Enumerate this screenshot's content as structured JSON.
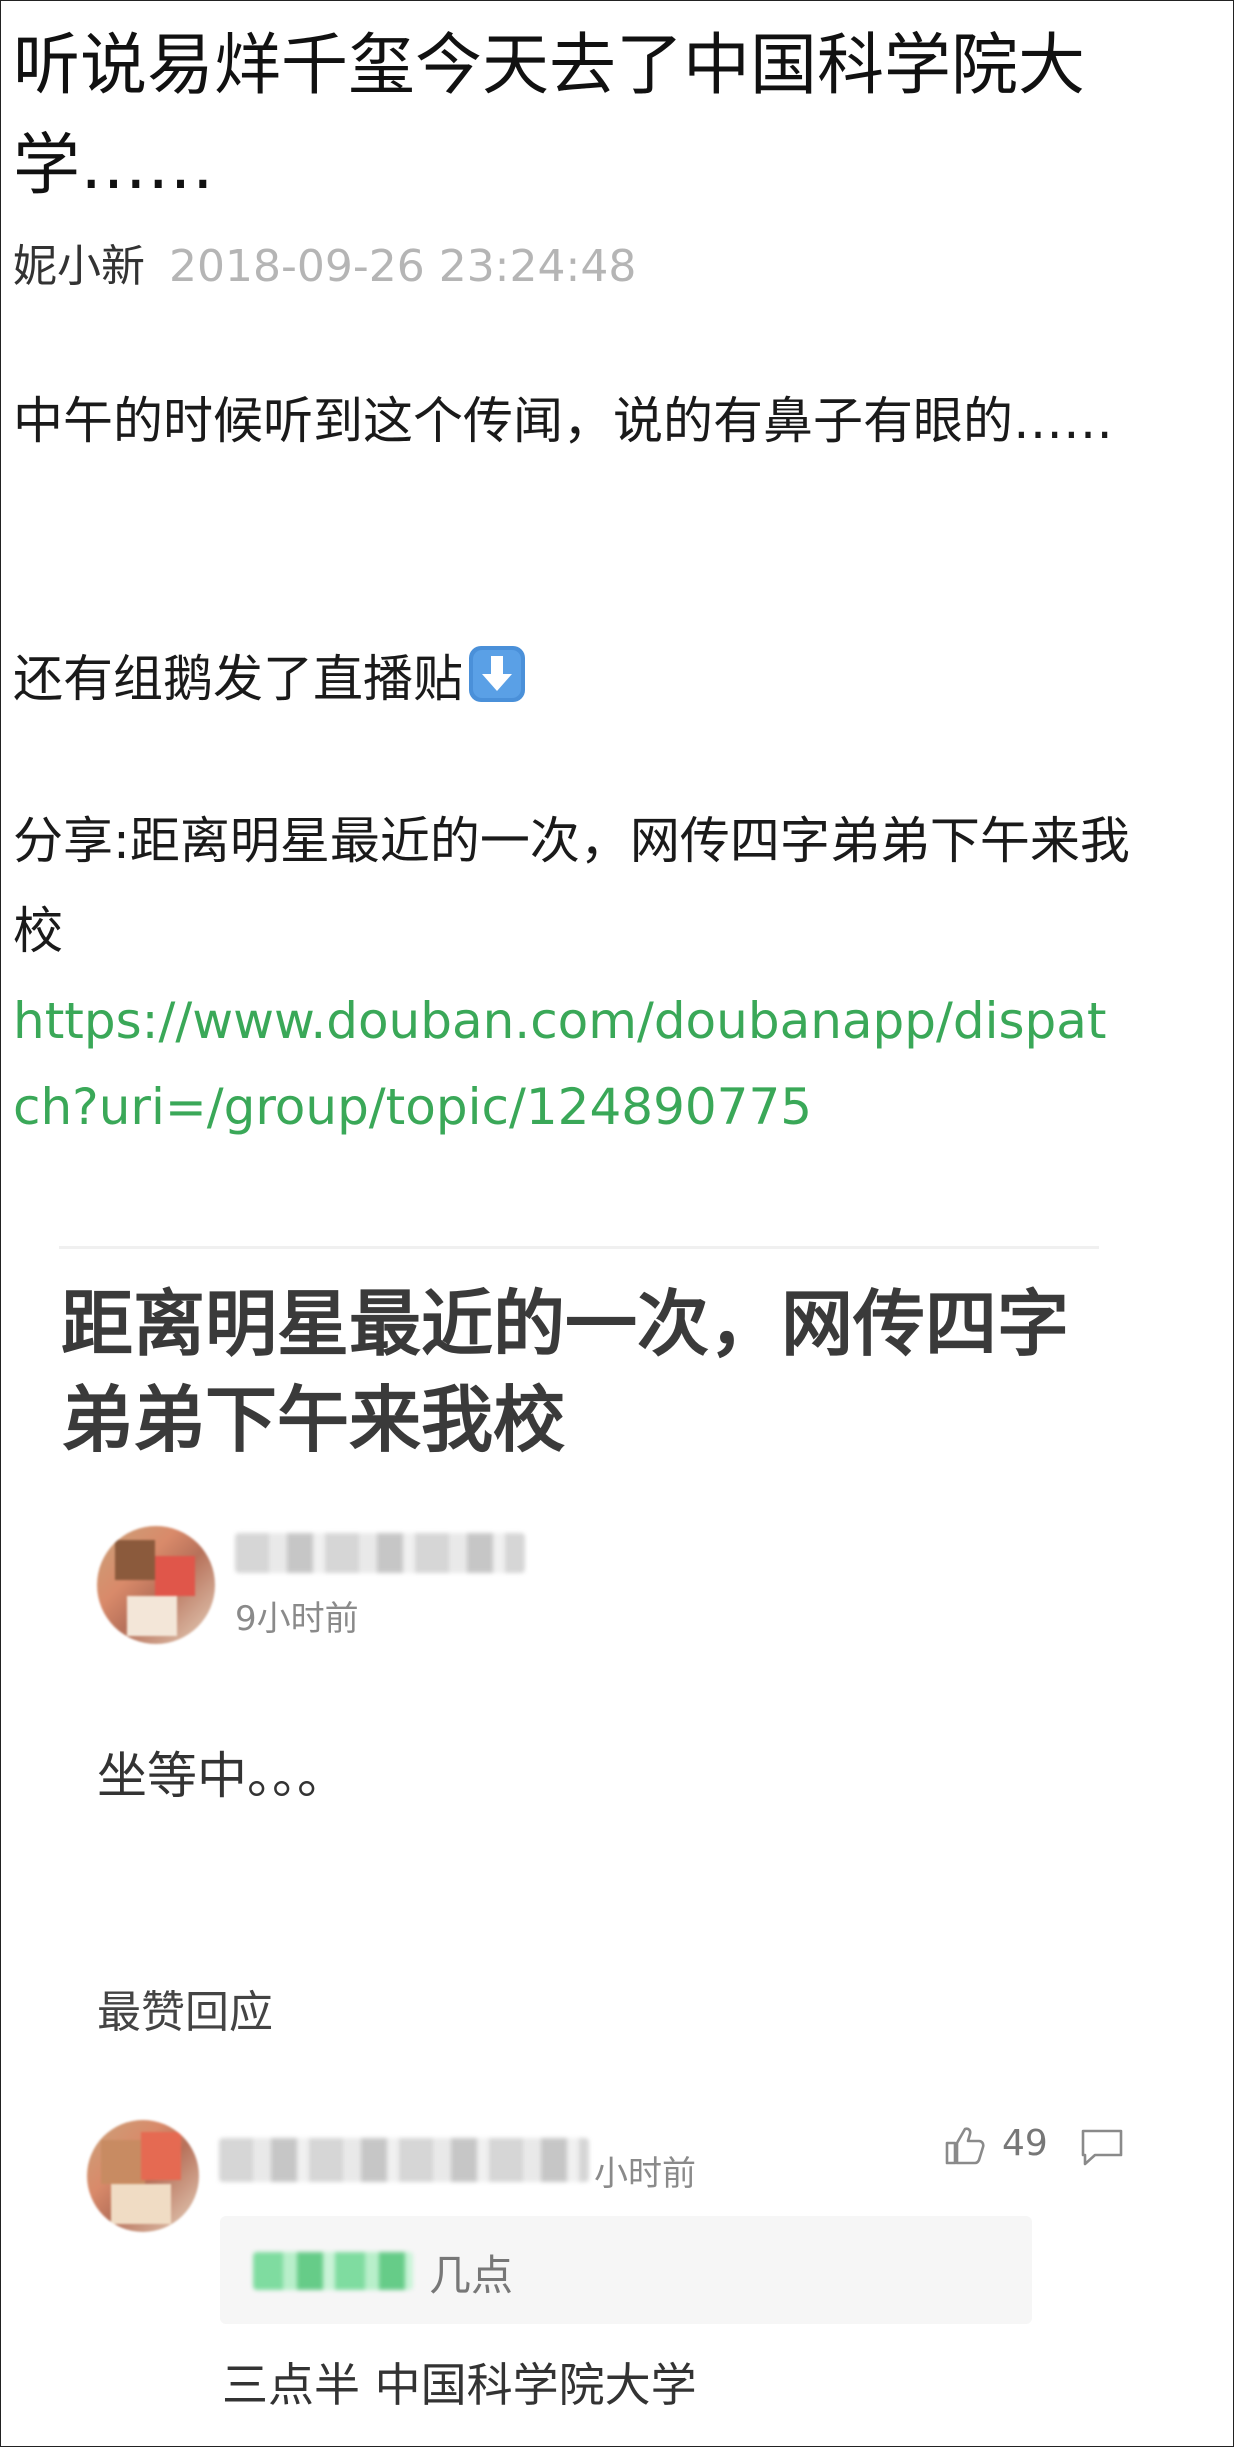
{
  "post": {
    "title": "听说易烊千玺今天去了中国科学院大学……",
    "author": "妮小新",
    "date": "2018-09-26 23:24:48",
    "paragraph1": "中午的时候听到这个传闻，说的有鼻子有眼的……",
    "paragraph2": "还有组鹅发了直播贴",
    "paragraph3": "分享:距离明星最近的一次，网传四字弟弟下午来我校",
    "link": "https://www.douban.com/doubanapp/dispatch?uri=/group/topic/124890775",
    "arrow_icon": "down-arrow-emoji-icon"
  },
  "embedded": {
    "title": "距离明星最近的一次，网传四字弟弟下午来我校",
    "poster_time": "9小时前",
    "body": "坐等中。。。",
    "section_label": "最赞回应",
    "top_reply": {
      "time": "小时前",
      "likes": "49",
      "quote_text": "几点",
      "reply_text": "三点半 中国科学院大学"
    }
  },
  "colors": {
    "link": "#3aa858",
    "date": "#b5b5b5",
    "card_title": "#3a3a3a"
  }
}
